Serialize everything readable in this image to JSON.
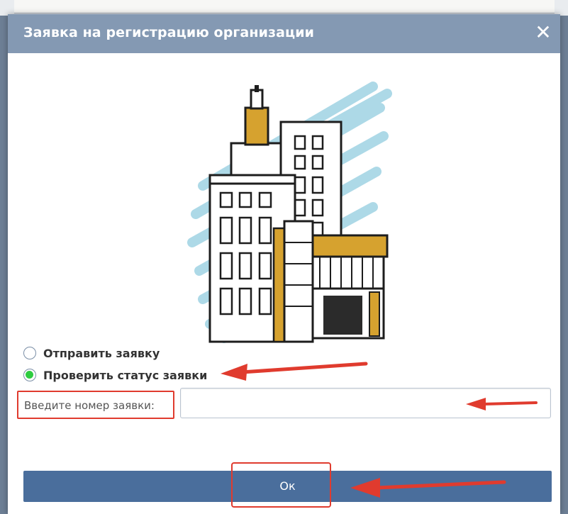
{
  "dialog": {
    "title": "Заявка на регистрацию организации",
    "close_symbol": "✕"
  },
  "options": [
    {
      "label": "Отправить заявку",
      "selected": false
    },
    {
      "label": "Проверить статус заявки",
      "selected": true
    }
  ],
  "request_number": {
    "label": "Введите номер заявки:",
    "value": ""
  },
  "ok_button": {
    "label": "Ок"
  },
  "colors": {
    "titlebar": "#8499b3",
    "button": "#4a6e9c",
    "annotation": "#e03b2e",
    "radio_selected": "#2ecc40",
    "illustration_accent": "#d6a22f",
    "illustration_splash": "#a9d7e6"
  }
}
